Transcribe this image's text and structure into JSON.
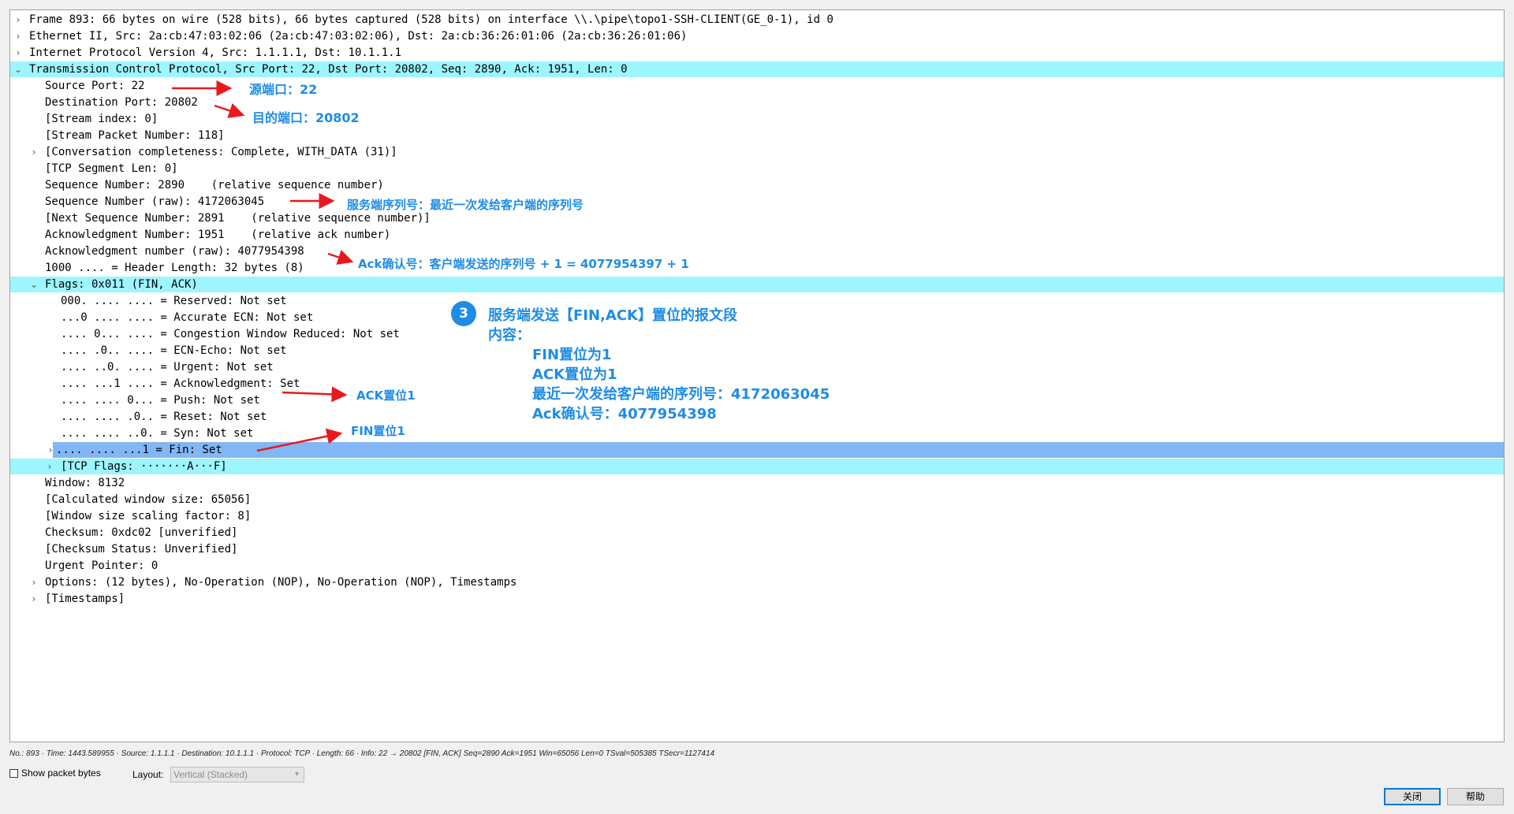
{
  "tree": {
    "rows": [
      {
        "text": "Frame 893: 66 bytes on wire (528 bits), 66 bytes captured (528 bits) on interface \\\\.\\pipe\\topo1-SSH-CLIENT(GE_0-1), id 0",
        "toggle": "›",
        "highlight": ""
      },
      {
        "text": "Ethernet II, Src: 2a:cb:47:03:02:06 (2a:cb:47:03:02:06), Dst: 2a:cb:36:26:01:06 (2a:cb:36:26:01:06)",
        "toggle": "›",
        "highlight": ""
      },
      {
        "text": "Internet Protocol Version 4, Src: 1.1.1.1, Dst: 10.1.1.1",
        "toggle": "›",
        "highlight": ""
      },
      {
        "text": "Transmission Control Protocol, Src Port: 22, Dst Port: 20802, Seq: 2890, Ack: 1951, Len: 0",
        "toggle": "⌄",
        "highlight": "cyan"
      },
      {
        "text": "Source Port: 22",
        "toggle": "",
        "highlight": ""
      },
      {
        "text": "Destination Port: 20802",
        "toggle": "",
        "highlight": ""
      },
      {
        "text": "[Stream index: 0]",
        "toggle": "",
        "highlight": ""
      },
      {
        "text": "[Stream Packet Number: 118]",
        "toggle": "",
        "highlight": ""
      },
      {
        "text": "[Conversation completeness: Complete, WITH_DATA (31)]",
        "toggle": "›",
        "highlight": ""
      },
      {
        "text": "[TCP Segment Len: 0]",
        "toggle": "",
        "highlight": ""
      },
      {
        "text": "Sequence Number: 2890    (relative sequence number)",
        "toggle": "",
        "highlight": ""
      },
      {
        "text": "Sequence Number (raw): 4172063045",
        "toggle": "",
        "highlight": ""
      },
      {
        "text": "[Next Sequence Number: 2891    (relative sequence number)]",
        "toggle": "",
        "highlight": ""
      },
      {
        "text": "Acknowledgment Number: 1951    (relative ack number)",
        "toggle": "",
        "highlight": ""
      },
      {
        "text": "Acknowledgment number (raw): 4077954398",
        "toggle": "",
        "highlight": ""
      },
      {
        "text": "1000 .... = Header Length: 32 bytes (8)",
        "toggle": "",
        "highlight": ""
      },
      {
        "text": "Flags: 0x011 (FIN, ACK)",
        "toggle": "⌄",
        "highlight": "cyan"
      },
      {
        "text": "000. .... .... = Reserved: Not set",
        "toggle": "",
        "highlight": ""
      },
      {
        "text": "...0 .... .... = Accurate ECN: Not set",
        "toggle": "",
        "highlight": ""
      },
      {
        "text": ".... 0... .... = Congestion Window Reduced: Not set",
        "toggle": "",
        "highlight": ""
      },
      {
        "text": ".... .0.. .... = ECN-Echo: Not set",
        "toggle": "",
        "highlight": ""
      },
      {
        "text": ".... ..0. .... = Urgent: Not set",
        "toggle": "",
        "highlight": ""
      },
      {
        "text": ".... ...1 .... = Acknowledgment: Set",
        "toggle": "",
        "highlight": ""
      },
      {
        "text": ".... .... 0... = Push: Not set",
        "toggle": "",
        "highlight": ""
      },
      {
        "text": ".... .... .0.. = Reset: Not set",
        "toggle": "",
        "highlight": ""
      },
      {
        "text": ".... .... ..0. = Syn: Not set",
        "toggle": "",
        "highlight": ""
      },
      {
        "text": ".... .... ...1 = Fin: Set",
        "toggle": "›",
        "highlight": "blue"
      },
      {
        "text": "[TCP Flags: ·······A···F]",
        "toggle": "›",
        "highlight": "cyan"
      },
      {
        "text": "Window: 8132",
        "toggle": "",
        "highlight": ""
      },
      {
        "text": "[Calculated window size: 65056]",
        "toggle": "",
        "highlight": ""
      },
      {
        "text": "[Window size scaling factor: 8]",
        "toggle": "",
        "highlight": ""
      },
      {
        "text": "Checksum: 0xdc02 [unverified]",
        "toggle": "",
        "highlight": ""
      },
      {
        "text": "[Checksum Status: Unverified]",
        "toggle": "",
        "highlight": ""
      },
      {
        "text": "Urgent Pointer: 0",
        "toggle": "",
        "highlight": ""
      },
      {
        "text": "Options: (12 bytes), No-Operation (NOP), No-Operation (NOP), Timestamps",
        "toggle": "›",
        "highlight": ""
      },
      {
        "text": "[Timestamps]",
        "toggle": "›",
        "highlight": ""
      }
    ]
  },
  "annotations": {
    "src_port": "源端口：22",
    "dst_port": "目的端口：20802",
    "seq_raw": "服务端序列号：最近一次发给客户端的序列号",
    "ack_raw": "Ack确认号：客户端发送的序列号 + 1 = 4077954397 + 1",
    "ack_flag": "ACK置位1",
    "fin_flag": "FIN置位1",
    "step_number": "3",
    "summary_title": "服务端发送【FIN,ACK】置位的报文段",
    "summary_content_label": "内容：",
    "summary_lines": [
      "FIN置位为1",
      "ACK置位为1",
      "最近一次发给客户端的序列号：4172063045",
      "Ack确认号：4077954398"
    ],
    "color": "#1e8ce6",
    "arrow_color": "#e8191e"
  },
  "status_bar": {
    "text": "No.: 893 · Time: 1443.589955 · Source: 1.1.1.1 · Destination: 10.1.1.1 · Protocol: TCP · Length: 66 · Info: 22 → 20802 [FIN, ACK] Seq=2890 Ack=1951 Win=65056 Len=0 TSval=505385 TSecr=1127414"
  },
  "controls": {
    "show_packet_bytes": "Show packet bytes",
    "layout_label": "Layout:",
    "layout_value": "Vertical (Stacked)",
    "close_label": "关闭",
    "help_label": "帮助"
  },
  "colors": {
    "highlight_cyan": "#9df5ff",
    "highlight_blue": "#83b6f5"
  }
}
